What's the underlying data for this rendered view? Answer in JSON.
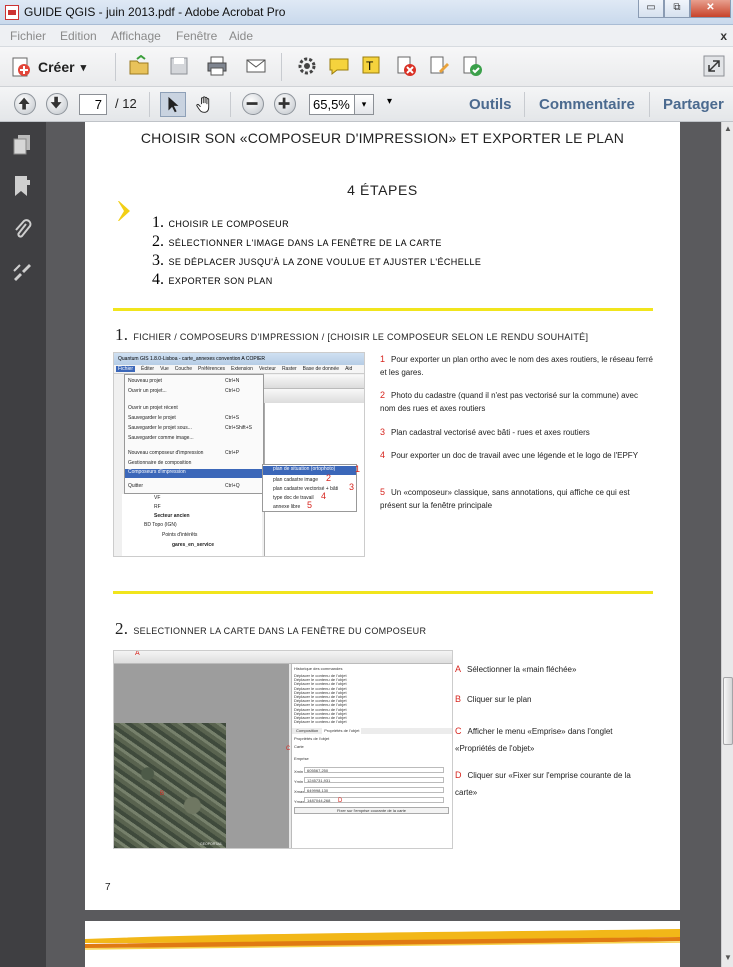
{
  "window": {
    "title": "GUIDE QGIS - juin 2013.pdf - Adobe Acrobat Pro",
    "min": "▭",
    "max": "⧉",
    "close": "✕"
  },
  "menu": {
    "items": [
      "Fichier",
      "Edition",
      "Affichage",
      "Fenêtre",
      "Aide"
    ],
    "close": "x"
  },
  "toolbar": {
    "create": "Créer",
    "create_arrow": "▾",
    "icons": [
      "open-icon",
      "save-icon",
      "print-icon",
      "mail-icon",
      "gear-icon",
      "comment-icon",
      "highlight-icon",
      "reject-icon",
      "sign-icon",
      "approve-icon",
      "expand-icon"
    ]
  },
  "nav": {
    "page": "7",
    "total": "/ 12",
    "zoom": "65,5%",
    "zoom_arrow": "▾",
    "more": "▾",
    "tools": "Outils",
    "comment": "Commentaire",
    "share": "Partager"
  },
  "doc": {
    "title": "CHOISIR SON «COMPOSEUR D'IMPRESSION» ET EXPORTER LE PLAN",
    "steps_title": "4 ÉTAPES",
    "steps": [
      {
        "n": "1.",
        "t": "CHOISIR LE COMPOSEUR"
      },
      {
        "n": "2.",
        "t": "SÉLECTIONNER L'IMAGE DANS LA FENÊTRE DE LA CARTE"
      },
      {
        "n": "3.",
        "t": "SE DÉPLACER JUSQU'À LA ZONE VOULUE ET AJUSTER L'ÉCHELLE"
      },
      {
        "n": "4.",
        "t": "EXPORTER SON PLAN"
      }
    ],
    "section1": {
      "n": "1.",
      "t": "FICHIER / COMPOSEURS D'IMPRESSION / [CHOISIR LE COMPOSEUR SELON LE RENDU SOUHAITÉ]"
    },
    "section1_items": [
      {
        "n": "1",
        "t": "Pour exporter  un plan ortho avec le nom des axes routiers, le réseau ferré et les gares."
      },
      {
        "n": "2",
        "t": "Photo du cadastre (quand il n'est pas vectorisé sur la commune) avec nom des rues et axes routiers"
      },
      {
        "n": "3",
        "t": "Plan cadastral vectorisé avec bâti - rues et axes routiers"
      },
      {
        "n": "4",
        "t": "Pour exporter un doc de travail avec une légende et le logo de l'EPFY"
      },
      {
        "n": "5",
        "t": "Un «composeur» classique, sans annotations, qui affiche ce qui est présent sur la fenêtre principale"
      }
    ],
    "section2": {
      "n": "2.",
      "t": "SELECTIONNER LA CARTE DANS LA FENÊTRE DU COMPOSEUR"
    },
    "section2_items": [
      {
        "n": "A",
        "t": "Sélectionner la «main fléchée»"
      },
      {
        "n": "B",
        "t": "Cliquer sur le plan"
      },
      {
        "n": "C",
        "t": "Afficher le menu «Emprise» dans l'onglet «Propriétés de l'objet»"
      },
      {
        "n": "D",
        "t": "Cliquer sur «Fixer sur l'emprise courante de la carte»"
      }
    ],
    "page_number": "7",
    "shot1": {
      "title": "Quantum GIS 1.8.0-Lisboa - carte_annexes convention A COPIER",
      "menu": [
        "Fichier",
        "Éditer",
        "Vue",
        "Couche",
        "Préférences",
        "Extension",
        "Vecteur",
        "Raster",
        "Base de donnée",
        "Aid"
      ],
      "items": [
        "Nouveau projet",
        "Ouvrir un projet...",
        "Ouvrir un projet récent",
        "Sauvegarder le projet",
        "Sauvegarder le projet sous...",
        "Sauvegarder comme image...",
        "Nouveau composeur d'impression",
        "Gestionnaire de composition",
        "Composeurs d'impression",
        "Quitter"
      ],
      "shortcuts": [
        "Ctrl+N",
        "Ctrl+O",
        "",
        "Ctrl+S",
        "Ctrl+Shift+S",
        "",
        "Ctrl+P",
        "",
        "",
        "Ctrl+Q"
      ],
      "submenu": [
        "plan de situation (ortophoto)",
        "plan cadastre image",
        "plan cadastre vectorisé + bâti",
        "type doc de travail",
        "annexe libre"
      ],
      "tree": [
        "VF",
        "RF",
        "Secteur ancien",
        "BD Topo (IGN)",
        "Points d'intérêts",
        "gares_en_service"
      ]
    },
    "shot2": {
      "panel_title": "Historique des commandes",
      "history": "Déplacer le contenu de l'objet",
      "tabs": [
        "Composition",
        "Propriétés de l'objet"
      ],
      "props": "Propriétés de l'objet",
      "carte": "Carte",
      "emprise": "Emprise",
      "fields": [
        "Xmin",
        "Ymin",
        "Xmax",
        "Ymax"
      ],
      "values": [
        "605567,250",
        "1245731,931",
        "649998,130",
        "1487044,268"
      ],
      "button": "Fixer sur l'emprise courante de la carte",
      "watermark": "GEOPORTAIL",
      "labels": {
        "a": "A",
        "b": "B",
        "c": "C",
        "d": "D"
      }
    }
  },
  "colors": {
    "accent": "#f1e51d",
    "red": "#d7261f",
    "blue_label": "#4b6a8f"
  }
}
